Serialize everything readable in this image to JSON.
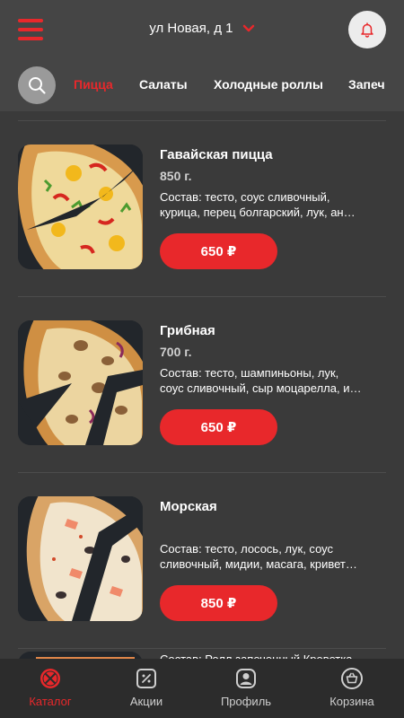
{
  "header": {
    "address": "ул Новая, д 1"
  },
  "categories": [
    {
      "label": "Пицца",
      "active": true
    },
    {
      "label": "Салаты",
      "active": false
    },
    {
      "label": "Холодные роллы",
      "active": false
    },
    {
      "label": "Запеч",
      "active": false
    }
  ],
  "products": [
    {
      "name": "Гавайская пицца",
      "weight": "850 г.",
      "desc_line1": "Состав: тесто, соус сливочный,",
      "desc_line2": "курица, перец болгарский, лук, ан…",
      "price": "650 ₽"
    },
    {
      "name": "Грибная",
      "weight": "700 г.",
      "desc_line1": "Состав: тесто, шампиньоны, лук,",
      "desc_line2": "соус сливочный, сыр моцарелла, и…",
      "price": "650 ₽"
    },
    {
      "name": "Морская",
      "weight": "",
      "desc_line1": "Состав: тесто, лосось, лук, соус",
      "desc_line2": "сливочный, мидии, масага, кривет…",
      "price": "850 ₽"
    },
    {
      "desc_line1": "Состав: Ролл запеченный Креветка"
    }
  ],
  "bottom_nav": [
    {
      "label": "Каталог",
      "icon": "catalog-icon",
      "active": true
    },
    {
      "label": "Акции",
      "icon": "promo-icon",
      "active": false
    },
    {
      "label": "Профиль",
      "icon": "profile-icon",
      "active": false
    },
    {
      "label": "Корзина",
      "icon": "cart-icon",
      "active": false
    }
  ],
  "colors": {
    "accent": "#e8282b",
    "background": "#3a3a3a",
    "header": "#454545",
    "nav": "#2c2c2c"
  }
}
